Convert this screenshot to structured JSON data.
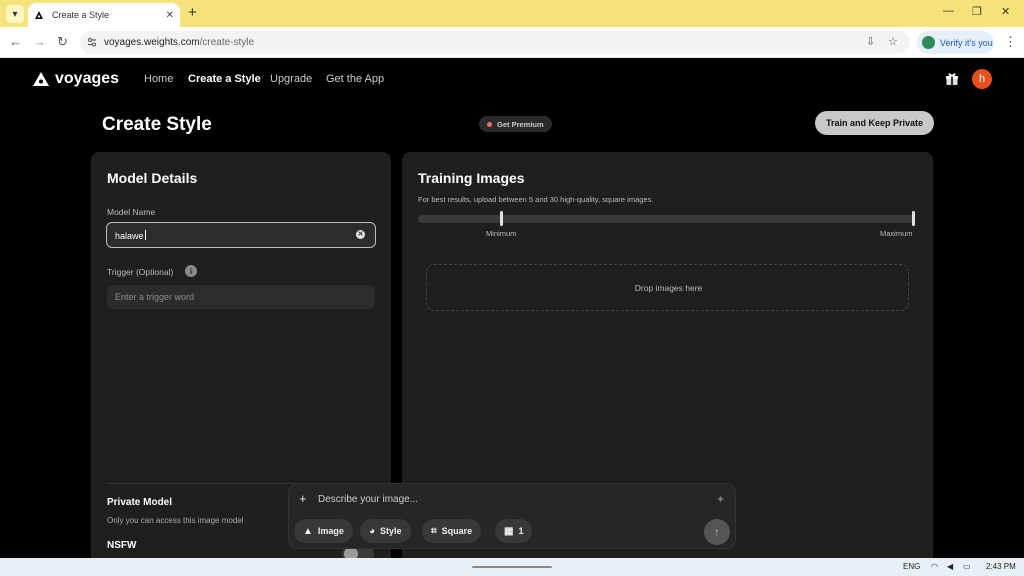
{
  "browser": {
    "tab_title": "Create a Style",
    "url_host": "voyages.weights.com",
    "url_path": "/create-style",
    "verify_label": "Verify it's you"
  },
  "site": {
    "logo": "voyages",
    "nav": [
      "Home",
      "Create a Style",
      "Upgrade",
      "Get the App"
    ],
    "active_nav": "Create a Style",
    "avatar_initial": "h"
  },
  "page": {
    "title": "Create Style",
    "premium_badge": "Get Premium",
    "train_button": "Train and Keep Private"
  },
  "model_details": {
    "heading": "Model Details",
    "name_label": "Model Name",
    "name_value": "halawe",
    "trigger_label": "Trigger (Optional)",
    "trigger_placeholder": "Enter a trigger word",
    "private_heading": "Private Model",
    "private_text": "Only you can access this image model",
    "nsfw_heading": "NSFW",
    "nsfw_enabled": false
  },
  "training": {
    "heading": "Training Images",
    "hint": "For best results, upload between 5 and 30 high-quality, square images.",
    "min_label": "Minimum",
    "max_label": "Maximum",
    "dropzone_text": "Drop images here"
  },
  "composer": {
    "placeholder": "Describe your image...",
    "chips": [
      "Image",
      "Style",
      "Square",
      "1"
    ]
  },
  "taskbar": {
    "lang": "ENG",
    "time": "2:43 PM"
  },
  "icons": {
    "tab_list": "chevron-down-icon",
    "back": "arrow-left-icon",
    "forward": "arrow-right-icon",
    "reload": "reload-icon",
    "gift": "gift-icon",
    "info": "info-icon",
    "sparkle": "sparkle-icon",
    "send": "arrow-up-icon"
  },
  "colors": {
    "tab_strip": "#f6e27a",
    "avatar": "#e8511e",
    "panel": "#1f1f1f",
    "premium_dot": "#f26b6b"
  }
}
